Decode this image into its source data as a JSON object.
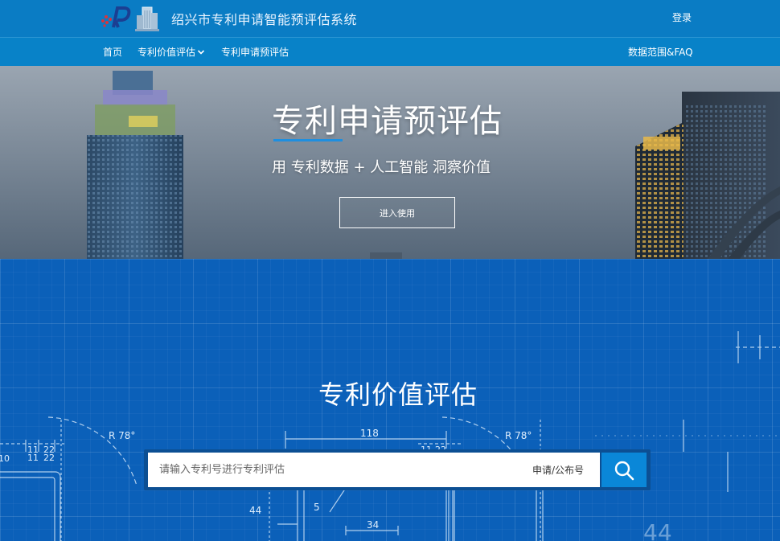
{
  "header": {
    "site_title": "绍兴市专利申请智能预评估系统",
    "login_label": "登录"
  },
  "nav": {
    "home": "首页",
    "patent_value": "专利价值评估",
    "pre_assessment": "专利申请预评估",
    "faq": "数据范围&FAQ"
  },
  "hero": {
    "title": "专利申请预评估",
    "subtitle": "用 专利数据 + 人工智能 洞察价值",
    "cta_label": "进入使用"
  },
  "valuation": {
    "title": "专利价值评估",
    "search_placeholder": "请输入专利号进行专利评估",
    "search_type": "申请/公布号"
  },
  "blueprint_labels": [
    "R 78°",
    "118",
    "11",
    "22",
    "R 78°",
    "11",
    "22",
    "10",
    "11",
    "22",
    "44",
    "5",
    "34",
    "44"
  ],
  "colors": {
    "header_bg": "#0a7cc4",
    "nav_bg": "#0882c8",
    "accent": "#1e8fe0",
    "blueprint_bg": "#0b60b9",
    "search_button": "#0a87d8"
  }
}
